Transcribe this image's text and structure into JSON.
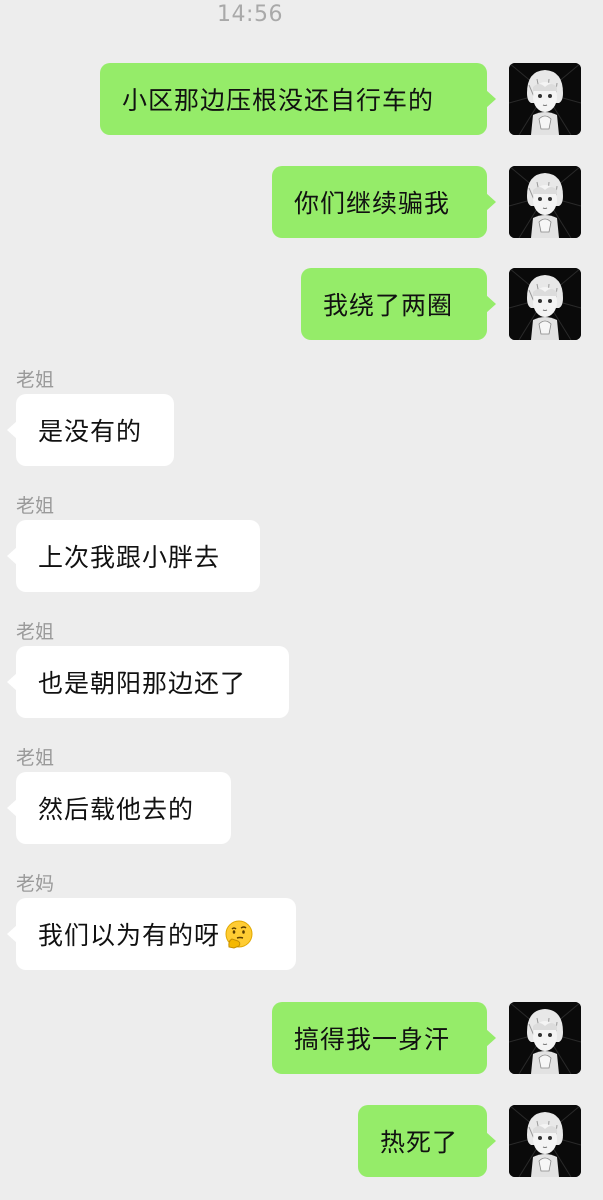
{
  "chat": {
    "timestamp": "14:56",
    "messages": [
      {
        "side": "out",
        "text": "小区那边压根没还自行车的"
      },
      {
        "side": "out",
        "text": "你们继续骗我"
      },
      {
        "side": "out",
        "text": "我绕了两圈"
      },
      {
        "side": "in",
        "sender": "老姐",
        "text": "是没有的"
      },
      {
        "side": "in",
        "sender": "老姐",
        "text": "上次我跟小胖去"
      },
      {
        "side": "in",
        "sender": "老姐",
        "text": "也是朝阳那边还了"
      },
      {
        "side": "in",
        "sender": "老姐",
        "text": "然后载他去的"
      },
      {
        "side": "in",
        "sender": "老妈",
        "text": "我们以为有的呀",
        "emoji": "thinking-face-emoji"
      },
      {
        "side": "out",
        "text": "搞得我一身汗"
      },
      {
        "side": "out",
        "text": "热死了"
      }
    ]
  },
  "colors": {
    "background": "#ededed",
    "outgoing_bubble": "#95ec69",
    "incoming_bubble": "#ffffff",
    "sender_name": "#9a9a9a",
    "timestamp": "#a9a9a9"
  },
  "icons": {
    "avatar": "manga-character-avatar",
    "emoji": "thinking-face-emoji"
  }
}
